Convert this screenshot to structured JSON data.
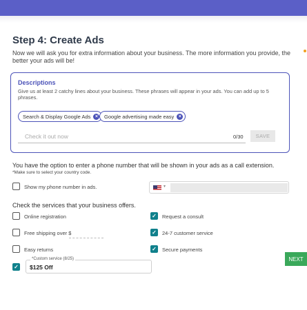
{
  "page": {
    "title": "Step 4: Create Ads",
    "intro": "Now we will ask you for extra information about your business. The more information you provide, the better your ads will be!"
  },
  "descriptions": {
    "title": "Descriptions",
    "help": "Give us at least 2 catchy lines about your business. These phrases will appear in your ads. You can add up to 5 phrases.",
    "chips": [
      "Search & Display Google Ads",
      "Google advertising made easy"
    ],
    "input_placeholder": "Check it out now",
    "input_value": "",
    "counter": "0/30",
    "save_label": "SAVE"
  },
  "phone": {
    "text": "You have the option to enter a phone number that will be shown in your ads as a call extension.",
    "note": "*Make sure to select your country code.",
    "checkbox_label": "Show my phone number in ads.",
    "checked": false,
    "flag_icon": "us-flag-icon",
    "number": ""
  },
  "services": {
    "title": "Check the services that your business offers.",
    "left": [
      {
        "label": "Online registration",
        "checked": false
      },
      {
        "label": "Free shipping over $",
        "checked": false
      },
      {
        "label": "Easy returns",
        "checked": false
      }
    ],
    "right": [
      {
        "label": "Request a consult",
        "checked": true
      },
      {
        "label": "24-7 customer service",
        "checked": true
      },
      {
        "label": "Secure payments",
        "checked": true
      }
    ],
    "custom": {
      "label": "*Custom service (8/25)",
      "value": "$125 Off",
      "checked": true
    }
  },
  "actions": {
    "next_label": "NEXT"
  },
  "colors": {
    "accent": "#4b52b8",
    "topbar": "#5b5fc7",
    "checkbox": "#10818c",
    "next": "#3aa85a"
  }
}
